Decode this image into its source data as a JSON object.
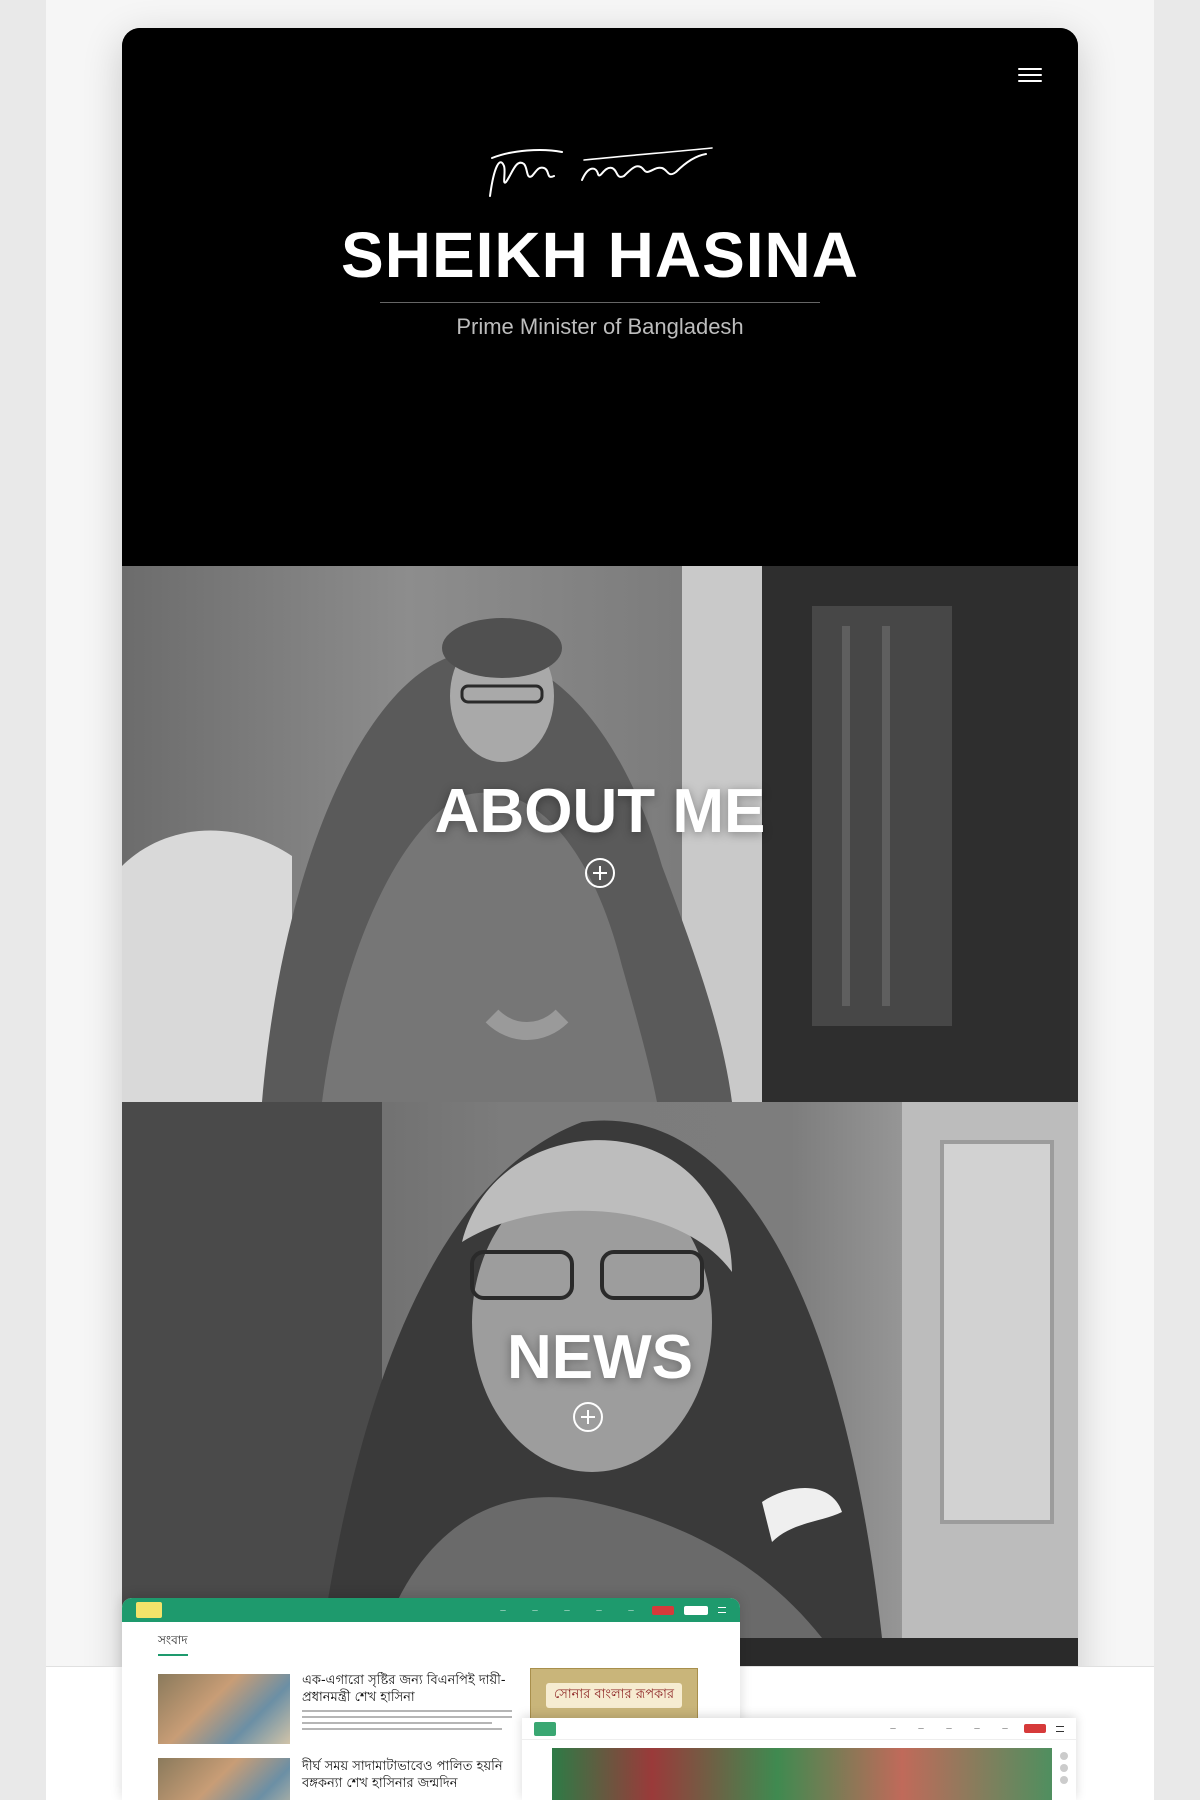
{
  "hero": {
    "name": "SHEIKH HASINA",
    "subtitle": "Prime Minister of Bangladesh"
  },
  "sections": {
    "about_title": "ABOUT ME",
    "news_title": "NEWS"
  },
  "preview_window": {
    "section_label": "সংবাদ",
    "article1_title": "এক-এগারো সৃষ্টির জন্য বিএনপিই দায়ী- প্রধানমন্ত্রী শেখ হাসিনা",
    "article2_title": "দীর্ঘ সময় সাদামাটাভাবেও পালিত হয়নি বঙ্গকন্যা শেখ হাসিনার জন্মদিন",
    "banner_text": "সোনার বাংলার রূপকার"
  },
  "colors": {
    "accent_green": "#1e9a6d",
    "hero_bg": "#000000"
  },
  "icons": {
    "menu": "hamburger-icon",
    "expand": "plus-circle-icon"
  }
}
